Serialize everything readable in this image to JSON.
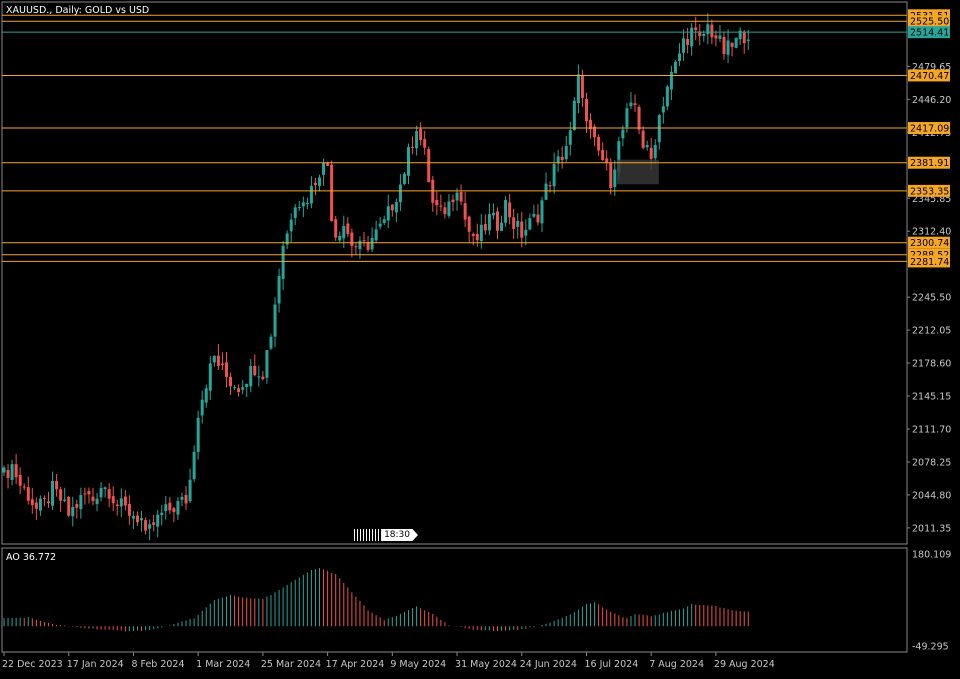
{
  "header": {
    "symbol": "XAUUSD.",
    "timeframe": "Daily",
    "description": "GOLD vs USD",
    "title": "XAUUSD., Daily:  GOLD vs USD"
  },
  "scroll_marker": {
    "label": "18:30"
  },
  "colors": {
    "background": "#000000",
    "bull": "#26a69a",
    "bear": "#ef5350",
    "level_line": "#f5a623",
    "current_line": "#26a69a",
    "ao_up": "#26a69a",
    "ao_down": "#ef5350",
    "axis_text": "#c8c8c8"
  },
  "chart_data": [
    {
      "type": "candlestick",
      "title": "XAUUSD., Daily:  GOLD vs USD",
      "xlabel": "",
      "ylabel": "",
      "ylim": [
        1995,
        2545
      ],
      "y_ticks": [
        "2011.35",
        "2044.80",
        "2078.25",
        "2111.70",
        "2145.15",
        "2178.60",
        "2212.05",
        "2245.50",
        "2312.40",
        "2345.85",
        "2412.75",
        "2446.20",
        "2479.65"
      ],
      "x_ticks": [
        {
          "label": "22 Dec 2023",
          "index": 0
        },
        {
          "label": "17 Jan 2024",
          "index": 16
        },
        {
          "label": "8 Feb 2024",
          "index": 32
        },
        {
          "label": "1 Mar 2024",
          "index": 48
        },
        {
          "label": "25 Mar 2024",
          "index": 64
        },
        {
          "label": "17 Apr 2024",
          "index": 80
        },
        {
          "label": "9 May 2024",
          "index": 96
        },
        {
          "label": "31 May 2024",
          "index": 112
        },
        {
          "label": "24 Jun 2024",
          "index": 128
        },
        {
          "label": "16 Jul 2024",
          "index": 144
        },
        {
          "label": "7 Aug 2024",
          "index": 160
        },
        {
          "label": "29 Aug 2024",
          "index": 176
        }
      ],
      "horizontal_levels": [
        {
          "value": 2531.51,
          "label": "2531.51",
          "kind": "level"
        },
        {
          "value": 2525.5,
          "label": "2525.50",
          "kind": "level"
        },
        {
          "value": 2514.41,
          "label": "2514.41",
          "kind": "current"
        },
        {
          "value": 2470.47,
          "label": "2470.47",
          "kind": "level"
        },
        {
          "value": 2417.09,
          "label": "2417.09",
          "kind": "level"
        },
        {
          "value": 2381.91,
          "label": "2381.91",
          "kind": "level"
        },
        {
          "value": 2353.35,
          "label": "2353.35",
          "kind": "level"
        },
        {
          "value": 2300.74,
          "label": "2300.74",
          "kind": "level"
        },
        {
          "value": 2288.52,
          "label": "2288.52",
          "kind": "level"
        },
        {
          "value": 2281.74,
          "label": "2281.74",
          "kind": "level"
        }
      ],
      "close_path": [
        [
          0,
          2065
        ],
        [
          2,
          2075
        ],
        [
          4,
          2055
        ],
        [
          6,
          2045
        ],
        [
          8,
          2030
        ],
        [
          10,
          2035
        ],
        [
          12,
          2050
        ],
        [
          14,
          2040
        ],
        [
          16,
          2025
        ],
        [
          18,
          2035
        ],
        [
          20,
          2045
        ],
        [
          22,
          2040
        ],
        [
          24,
          2055
        ],
        [
          26,
          2050
        ],
        [
          28,
          2035
        ],
        [
          30,
          2030
        ],
        [
          32,
          2025
        ],
        [
          34,
          2020
        ],
        [
          35,
          2000
        ],
        [
          37,
          2015
        ],
        [
          39,
          2025
        ],
        [
          41,
          2030
        ],
        [
          43,
          2035
        ],
        [
          45,
          2040
        ],
        [
          46,
          2060
        ],
        [
          47,
          2095
        ],
        [
          48,
          2130
        ],
        [
          50,
          2160
        ],
        [
          52,
          2185
        ],
        [
          54,
          2170
        ],
        [
          56,
          2160
        ],
        [
          58,
          2155
        ],
        [
          60,
          2165
        ],
        [
          62,
          2175
        ],
        [
          64,
          2170
        ],
        [
          65,
          2190
        ],
        [
          66,
          2210
        ],
        [
          67,
          2240
        ],
        [
          68,
          2270
        ],
        [
          69,
          2300
        ],
        [
          70,
          2310
        ],
        [
          71,
          2330
        ],
        [
          72,
          2345
        ],
        [
          74,
          2340
        ],
        [
          76,
          2355
        ],
        [
          78,
          2375
        ],
        [
          80,
          2380
        ],
        [
          81,
          2330
        ],
        [
          82,
          2310
        ],
        [
          84,
          2320
        ],
        [
          86,
          2300
        ],
        [
          88,
          2295
        ],
        [
          90,
          2300
        ],
        [
          92,
          2310
        ],
        [
          94,
          2320
        ],
        [
          96,
          2340
        ],
        [
          98,
          2360
        ],
        [
          100,
          2390
        ],
        [
          102,
          2420
        ],
        [
          104,
          2390
        ],
        [
          106,
          2340
        ],
        [
          108,
          2330
        ],
        [
          110,
          2340
        ],
        [
          112,
          2360
        ],
        [
          114,
          2325
        ],
        [
          116,
          2300
        ],
        [
          118,
          2310
        ],
        [
          120,
          2325
        ],
        [
          122,
          2320
        ],
        [
          124,
          2340
        ],
        [
          126,
          2320
        ],
        [
          128,
          2310
        ],
        [
          130,
          2320
        ],
        [
          132,
          2330
        ],
        [
          134,
          2355
        ],
        [
          136,
          2375
        ],
        [
          138,
          2390
        ],
        [
          140,
          2410
        ],
        [
          141,
          2440
        ],
        [
          142,
          2465
        ],
        [
          143,
          2455
        ],
        [
          144,
          2420
        ],
        [
          146,
          2400
        ],
        [
          148,
          2385
        ],
        [
          150,
          2365
        ],
        [
          152,
          2400
        ],
        [
          154,
          2430
        ],
        [
          156,
          2440
        ],
        [
          158,
          2400
        ],
        [
          160,
          2385
        ],
        [
          162,
          2430
        ],
        [
          164,
          2460
        ],
        [
          166,
          2480
        ],
        [
          168,
          2505
        ],
        [
          170,
          2515
        ],
        [
          172,
          2505
        ],
        [
          174,
          2520
        ],
        [
          176,
          2510
        ],
        [
          178,
          2495
        ],
        [
          180,
          2500
        ],
        [
          182,
          2510
        ],
        [
          184,
          2514.41
        ]
      ],
      "current_price": 2514.41
    },
    {
      "type": "bar",
      "title": "AO 36.772",
      "indicator": "AO",
      "last_value": 36.772,
      "ylim": [
        -49.295,
        180.109
      ],
      "y_ticks": [
        "180.109",
        "-49.295"
      ],
      "series": [
        {
          "name": "AO",
          "control_points": [
            [
              0,
              20
            ],
            [
              6,
              22
            ],
            [
              12,
              5
            ],
            [
              20,
              -5
            ],
            [
              30,
              -12
            ],
            [
              36,
              -10
            ],
            [
              42,
              5
            ],
            [
              47,
              20
            ],
            [
              52,
              65
            ],
            [
              56,
              78
            ],
            [
              60,
              70
            ],
            [
              64,
              68
            ],
            [
              68,
              90
            ],
            [
              72,
              115
            ],
            [
              76,
              140
            ],
            [
              78,
              145
            ],
            [
              82,
              130
            ],
            [
              86,
              85
            ],
            [
              90,
              40
            ],
            [
              94,
              15
            ],
            [
              98,
              30
            ],
            [
              102,
              50
            ],
            [
              106,
              30
            ],
            [
              110,
              2
            ],
            [
              116,
              -8
            ],
            [
              122,
              -12
            ],
            [
              128,
              -8
            ],
            [
              134,
              5
            ],
            [
              140,
              30
            ],
            [
              144,
              55
            ],
            [
              146,
              60
            ],
            [
              150,
              35
            ],
            [
              154,
              20
            ],
            [
              156,
              30
            ],
            [
              160,
              25
            ],
            [
              164,
              35
            ],
            [
              168,
              45
            ],
            [
              170,
              55
            ],
            [
              176,
              50
            ],
            [
              180,
              40
            ],
            [
              184,
              36.772
            ]
          ]
        }
      ]
    }
  ]
}
